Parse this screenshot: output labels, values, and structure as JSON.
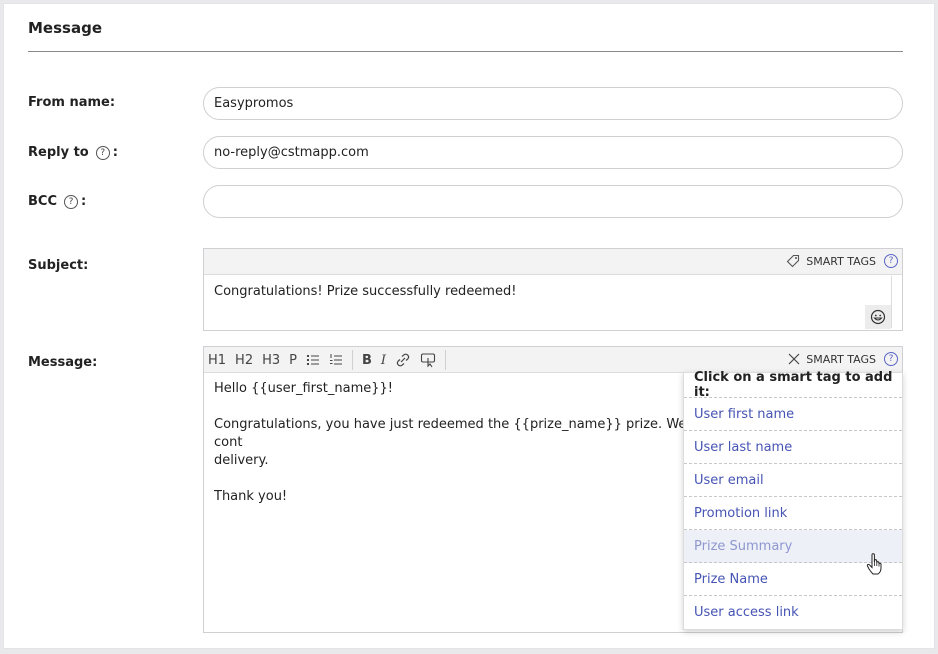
{
  "section": {
    "title": "Message"
  },
  "form": {
    "from_name": {
      "label": "From name:",
      "value": "Easypromos"
    },
    "reply_to": {
      "label": "Reply to",
      "value": "no-reply@cstmapp.com"
    },
    "bcc": {
      "label": "BCC",
      "value": ""
    },
    "subject": {
      "label": "Subject:",
      "value": "Congratulations! Prize successfully redeemed!"
    },
    "message": {
      "label": "Message:"
    }
  },
  "help_glyph": "?",
  "colon": ":",
  "smart_tags_label": "SMART TAGS",
  "toolbar": {
    "h1": "H1",
    "h2": "H2",
    "h3": "H3",
    "p": "P",
    "bold": "B",
    "italic": "I"
  },
  "message_body": {
    "line1": "Hello {{user_first_name}}!",
    "line2": "Congratulations, you have just redeemed the {{prize_name}} prize. We will cont",
    "line3": "delivery.",
    "line4": "Thank you!"
  },
  "smart_tags_dropdown": {
    "header": "Click on a smart tag to add it:",
    "items": [
      {
        "label": "User first name"
      },
      {
        "label": "User last name"
      },
      {
        "label": "User email"
      },
      {
        "label": "Promotion link"
      },
      {
        "label": "Prize Summary"
      },
      {
        "label": "Prize Name"
      },
      {
        "label": "User access link"
      }
    ],
    "hovered_index": 4
  },
  "icons": [
    "tag-icon",
    "help-icon",
    "close-icon",
    "emoji-icon",
    "bullet-list-icon",
    "numbered-list-icon",
    "link-icon",
    "button-icon",
    "hand-cursor-icon"
  ]
}
